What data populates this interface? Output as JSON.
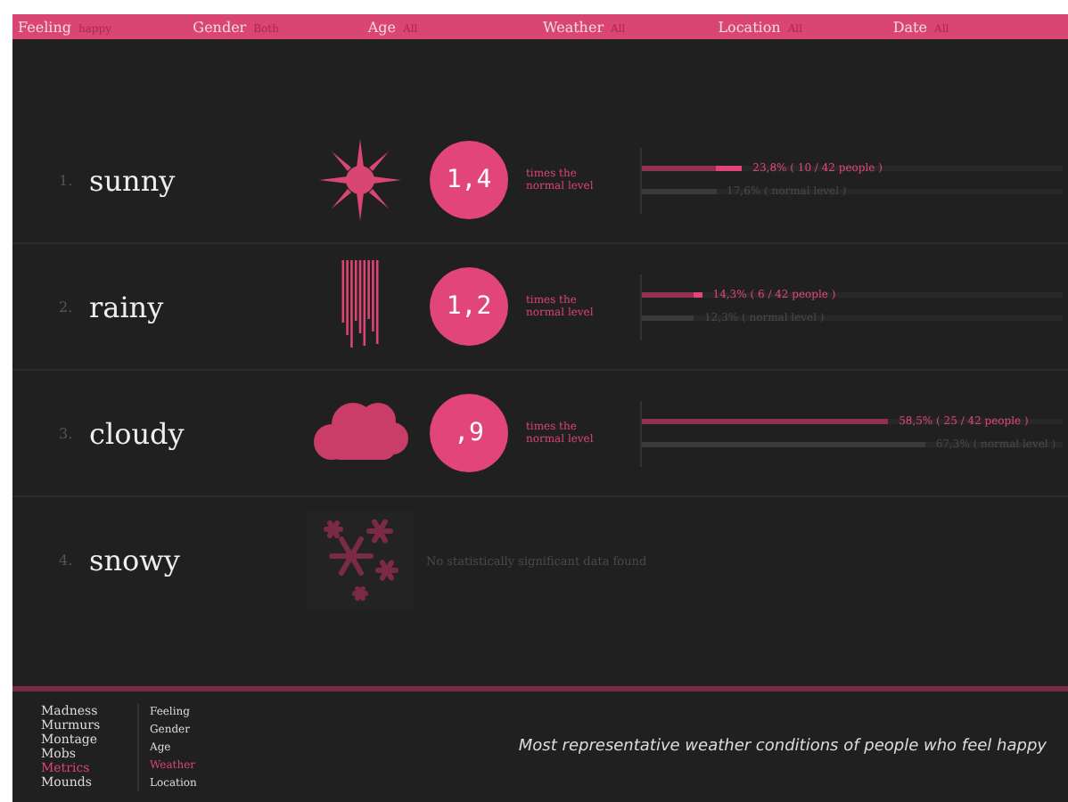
{
  "filters": [
    {
      "label": "Feeling",
      "value": "happy"
    },
    {
      "label": "Gender",
      "value": "Both"
    },
    {
      "label": "Age",
      "value": "All"
    },
    {
      "label": "Weather",
      "value": "All"
    },
    {
      "label": "Location",
      "value": "All"
    },
    {
      "label": "Date",
      "value": "All"
    }
  ],
  "rows": [
    {
      "kind": "stats",
      "rank": "1.",
      "name": "sunny",
      "ratio": "1,4",
      "caption": "times the normal level",
      "people": {
        "level": 0.238,
        "text": "23,8% ( 10 / 42 people )"
      },
      "normal": {
        "level": 0.176,
        "text": "17,6% ( normal level )"
      }
    },
    {
      "kind": "stats",
      "rank": "2.",
      "name": "rainy",
      "ratio": "1,2",
      "caption": "times the normal level",
      "people": {
        "level": 0.143,
        "text": "14,3% ( 6 / 42 people )"
      },
      "normal": {
        "level": 0.123,
        "text": "12,3% ( normal level )"
      }
    },
    {
      "kind": "stats",
      "rank": "3.",
      "name": "cloudy",
      "ratio": ",9",
      "caption": "times the normal level",
      "people": {
        "level": 0.585,
        "text": "58,5% ( 25 / 42 people )"
      },
      "normal": {
        "level": 0.673,
        "text": "67,3% ( normal level )"
      }
    },
    {
      "kind": "no-data",
      "rank": "4.",
      "name": "snowy",
      "message": "No statistically significant data found"
    }
  ],
  "footer": {
    "sections": [
      {
        "label": "Madness",
        "selected": false
      },
      {
        "label": "Murmurs",
        "selected": false
      },
      {
        "label": "Montage",
        "selected": false
      },
      {
        "label": "Mobs",
        "selected": false
      },
      {
        "label": "Metrics",
        "selected": true
      },
      {
        "label": "Mounds",
        "selected": false
      }
    ],
    "metrics": [
      {
        "label": "Feeling",
        "selected": false
      },
      {
        "label": "Gender",
        "selected": false
      },
      {
        "label": "Age",
        "selected": false
      },
      {
        "label": "Weather",
        "selected": true
      },
      {
        "label": "Location",
        "selected": false
      }
    ],
    "caption": "Most representative weather conditions of people who feel happy"
  }
}
